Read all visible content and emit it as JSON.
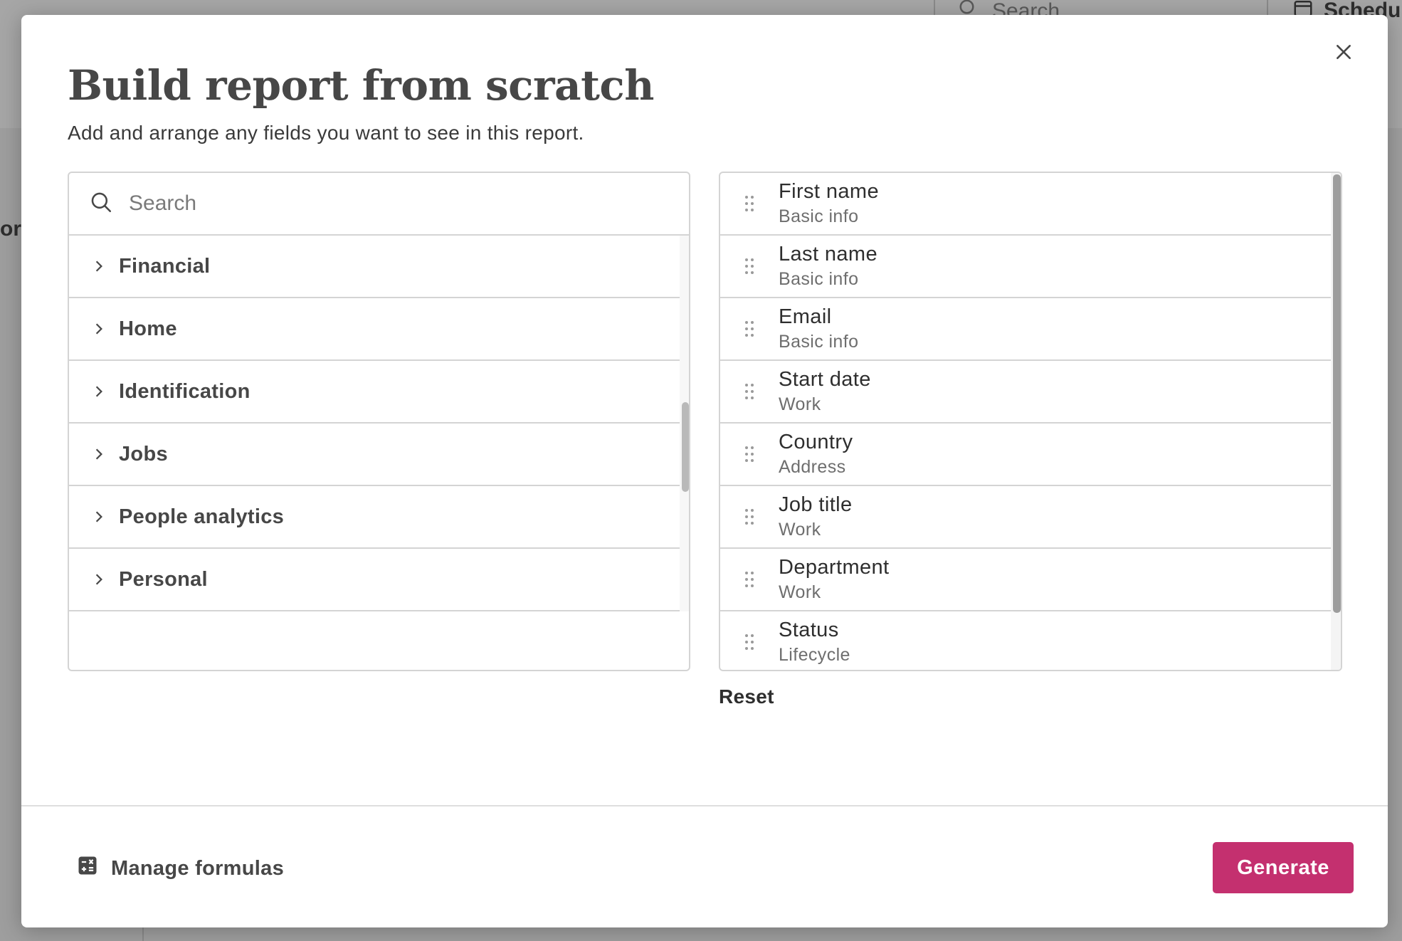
{
  "background": {
    "search_label": "Search",
    "schedule_label": "Schedu",
    "left_fragment": "or"
  },
  "modal": {
    "title": "Build report from scratch",
    "subtitle": "Add and arrange any fields you want to see in this report.",
    "close_icon": "close-icon"
  },
  "search": {
    "placeholder": "Search",
    "value": ""
  },
  "categories": [
    {
      "label": "Financial"
    },
    {
      "label": "Home"
    },
    {
      "label": "Identification"
    },
    {
      "label": "Jobs"
    },
    {
      "label": "People analytics"
    },
    {
      "label": "Personal"
    }
  ],
  "fields": [
    {
      "name": "First name",
      "group": "Basic info"
    },
    {
      "name": "Last name",
      "group": "Basic info"
    },
    {
      "name": "Email",
      "group": "Basic info"
    },
    {
      "name": "Start date",
      "group": "Work"
    },
    {
      "name": "Country",
      "group": "Address"
    },
    {
      "name": "Job title",
      "group": "Work"
    },
    {
      "name": "Department",
      "group": "Work"
    },
    {
      "name": "Status",
      "group": "Lifecycle"
    }
  ],
  "actions": {
    "reset_label": "Reset",
    "manage_formulas_label": "Manage formulas",
    "generate_label": "Generate"
  },
  "colors": {
    "primary": "#c4306f",
    "text": "#474747",
    "border": "#d4d4d4"
  }
}
